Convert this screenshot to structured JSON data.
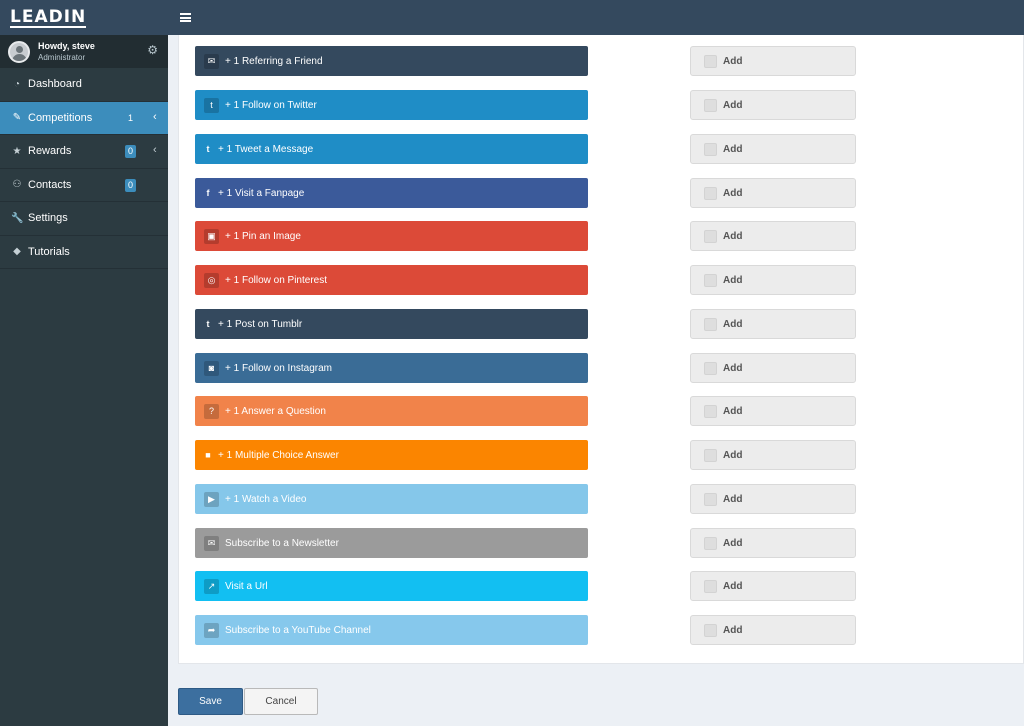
{
  "brand": {
    "logo_text": "LEADIN"
  },
  "user": {
    "greeting": "Howdy, steve",
    "role": "Administrator"
  },
  "sidebar": {
    "items": [
      {
        "label": "Dashboard",
        "icon": "dashboard-icon"
      },
      {
        "label": "Competitions",
        "icon": "pencil-icon",
        "badge": "1",
        "active": true
      },
      {
        "label": "Rewards",
        "icon": "star-icon",
        "badge": "0"
      },
      {
        "label": "Contacts",
        "icon": "users-icon",
        "badge": "0"
      },
      {
        "label": "Settings",
        "icon": "wrench-icon"
      },
      {
        "label": "Tutorials",
        "icon": "tag-icon"
      }
    ]
  },
  "entries": [
    {
      "label": "+ 1 Referring a Friend",
      "icon": "envelope-icon",
      "color": "#34495e"
    },
    {
      "label": "+ 1 Follow on Twitter",
      "icon": "twitter-icon",
      "color": "#1f8dc6"
    },
    {
      "label": "+ 1 Tweet a Message",
      "icon": "twitter-icon",
      "color": "#1f8dc6"
    },
    {
      "label": "+ 1 Visit a Fanpage",
      "icon": "facebook-icon",
      "color": "#3b5a9a"
    },
    {
      "label": "+ 1 Pin an Image",
      "icon": "image-icon",
      "color": "#dc4a38"
    },
    {
      "label": "+ 1 Follow on Pinterest",
      "icon": "pinterest-icon",
      "color": "#dc4a38"
    },
    {
      "label": "+ 1 Post on Tumblr",
      "icon": "tumblr-icon",
      "color": "#34495e"
    },
    {
      "label": "+ 1 Follow on Instagram",
      "icon": "instagram-icon",
      "color": "#3a6c96"
    },
    {
      "label": "+ 1 Answer a Question",
      "icon": "question-icon",
      "color": "#f1834a"
    },
    {
      "label": "+ 1 Multiple Choice Answer",
      "icon": "square-icon",
      "color": "#fb8500"
    },
    {
      "label": "+ 1 Watch a Video",
      "icon": "youtube-icon",
      "color": "#85c7ea"
    },
    {
      "label": "Subscribe to a Newsletter",
      "icon": "envelope-icon",
      "color": "#9b9b9b"
    },
    {
      "label": "Visit a Url",
      "icon": "external-link-icon",
      "color": "#12bff2"
    },
    {
      "label": "Subscribe to a YouTube Channel",
      "icon": "share-icon",
      "color": "#86c8ec"
    }
  ],
  "add_label": "Add",
  "footer": {
    "save_label": "Save",
    "cancel_label": "Cancel"
  }
}
